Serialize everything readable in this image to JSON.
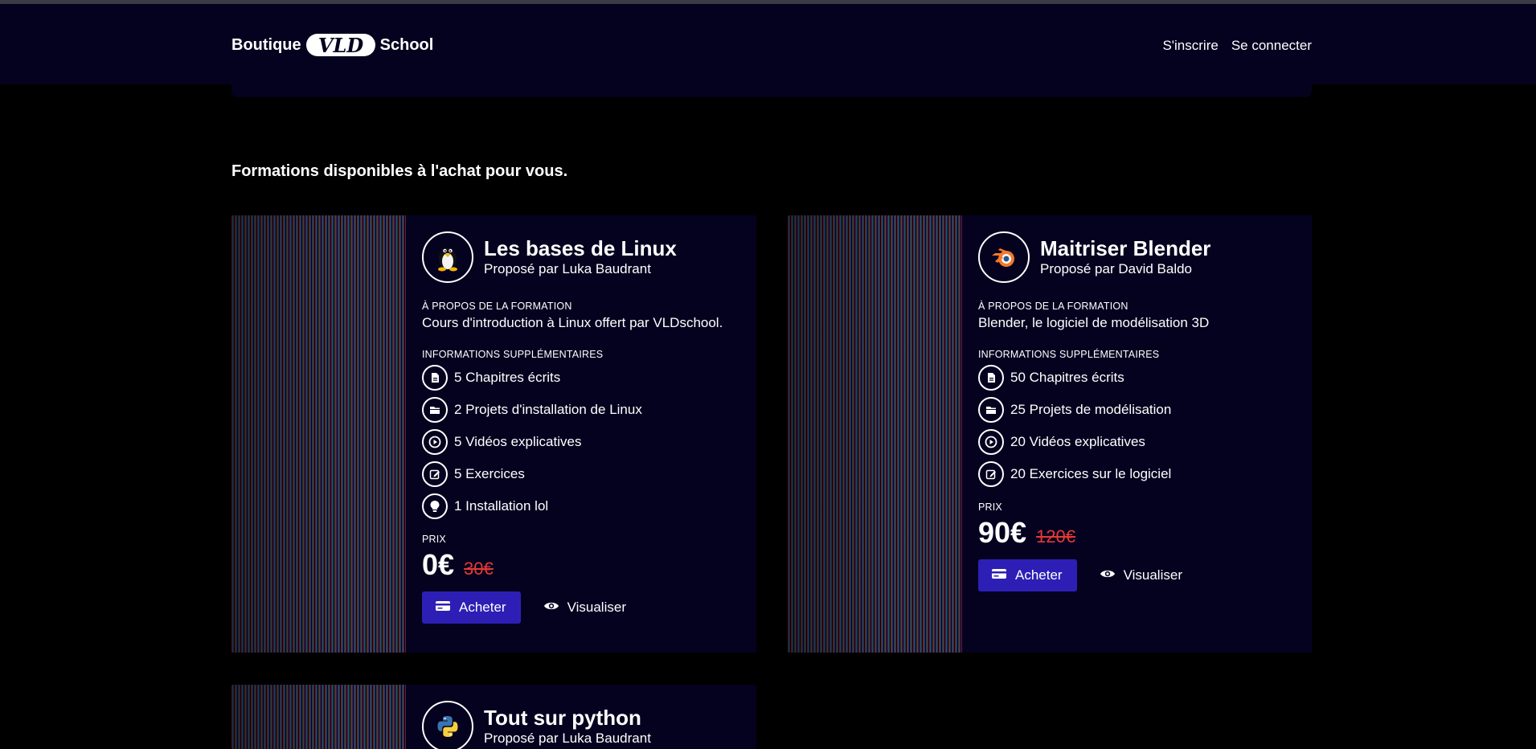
{
  "header": {
    "brand_left": "Boutique",
    "brand_logo": "VLD",
    "brand_right": "School",
    "nav": {
      "signup": "S'inscrire",
      "login": "Se connecter"
    }
  },
  "main": {
    "title": "Formations disponibles à l'achat pour vous."
  },
  "labels": {
    "about": "À PROPOS DE LA FORMATION",
    "extra": "INFORMATIONS SUPPLÉMENTAIRES",
    "price": "PRIX",
    "buy": "Acheter",
    "view": "Visualiser"
  },
  "courses": [
    {
      "title": "Les bases de Linux",
      "author": "Proposé par Luka Baudrant",
      "icon": "linux-tux-icon",
      "about": "Cours d'introduction à Linux offert par VLDschool.",
      "info": [
        {
          "icon": "document-icon",
          "text": "5 Chapitres écrits"
        },
        {
          "icon": "folder-icon",
          "text": "2 Projets d'installation de Linux"
        },
        {
          "icon": "play-icon",
          "text": "5 Vidéos explicatives"
        },
        {
          "icon": "edit-icon",
          "text": "5 Exercices"
        },
        {
          "icon": "lightbulb-icon",
          "text": "1 Installation lol"
        }
      ],
      "price": "0€",
      "old_price": "30€"
    },
    {
      "title": "Maitriser Blender",
      "author": "Proposé par David Baldo",
      "icon": "blender-icon",
      "about": "Blender, le logiciel de modélisation 3D",
      "info": [
        {
          "icon": "document-icon",
          "text": "50 Chapitres écrits"
        },
        {
          "icon": "folder-icon",
          "text": "25 Projets de modélisation"
        },
        {
          "icon": "play-icon",
          "text": "20 Vidéos explicatives"
        },
        {
          "icon": "edit-icon",
          "text": "20 Exercices sur le logiciel"
        }
      ],
      "price": "90€",
      "old_price": "120€"
    },
    {
      "title": "Tout sur python",
      "author": "Proposé par Luka Baudrant",
      "icon": "python-icon"
    }
  ],
  "colors": {
    "page_bg": "#000000",
    "card_bg": "#05021f",
    "buy_button": "#2d1fb5",
    "old_price": "#e53935"
  }
}
